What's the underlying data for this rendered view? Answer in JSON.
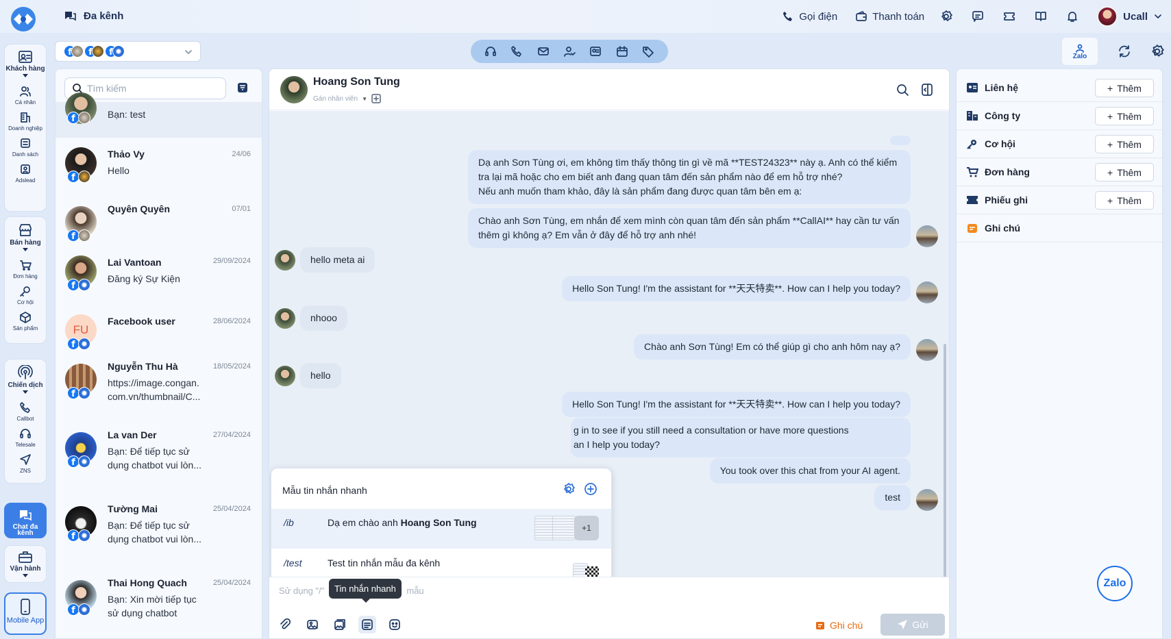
{
  "topbar": {
    "brand": "Đa kênh",
    "call": "Gọi điện",
    "payment": "Thanh toán",
    "user": "Ucall"
  },
  "rail": {
    "customers": "Khách hàng",
    "personal": "Cá nhân",
    "business": "Doanh nghiệp",
    "list": "Danh sách",
    "adslead": "Adslead",
    "sales": "Bán hàng",
    "orders": "Đơn hàng",
    "opportunity": "Cơ hội",
    "products": "Sản phẩm",
    "campaign": "Chiến dịch",
    "callbot": "Callbot",
    "telesale": "Telesale",
    "zns": "ZNS",
    "chat": "Chat đa kênh",
    "operations": "Vận hành",
    "mobile": "Mobile App"
  },
  "right_toolbar": {
    "zalo_tab": "Zalo"
  },
  "search": {
    "placeholder": "Tìm kiếm"
  },
  "conversations": [
    {
      "name": "",
      "date": "",
      "preview": "Bạn: test"
    },
    {
      "name": "Thảo Vy",
      "date": "24/06",
      "preview": "Hello"
    },
    {
      "name": "Quyên Quyên",
      "date": "07/01",
      "preview": ""
    },
    {
      "name": "Lai Vantoan",
      "date": "29/09/2024",
      "preview": "Đăng ký Sự Kiện"
    },
    {
      "name": "Facebook user",
      "date": "28/06/2024",
      "preview": "",
      "initials": "FU"
    },
    {
      "name": "Nguyễn Thu Hà",
      "date": "18/05/2024",
      "preview": "https://image.congan.com.vn/thumbnail/C..."
    },
    {
      "name": "La van Der",
      "date": "27/04/2024",
      "preview": "Bạn: Để tiếp tục sử dụng chatbot vui lòn..."
    },
    {
      "name": "Tường Mai",
      "date": "25/04/2024",
      "preview": "Bạn: Để tiếp tục sử dụng chatbot vui lòn..."
    },
    {
      "name": "Thai Hong Quach",
      "date": "25/04/2024",
      "preview": "Bạn: Xin mời tiếp tục sử dụng chatbot"
    }
  ],
  "chat": {
    "contact_name": "Hoang Son Tung",
    "assign": "Gán nhân viên",
    "messages": {
      "m1": "Dạ anh Sơn Tùng ơi, em không tìm thấy thông tin gì về mã **TEST24323** này ạ. Anh có thể kiểm tra lại mã hoặc cho em biết anh đang quan tâm đến sản phẩm nào để em hỗ trợ nhé?",
      "m1b": "Nếu anh muốn tham khảo, đây là sản phẩm đang được quan tâm bên em ạ:",
      "m2": "Chào anh Sơn Tùng, em nhắn để xem mình còn quan tâm đến sản phẩm **CallAI** hay cần tư vấn thêm gì không ạ? Em vẫn ở đây để hỗ trợ anh nhé!",
      "m3": "hello meta ai",
      "m4": "Hello Son Tung! I'm the assistant for **天天特卖**. How can I help you today?",
      "m5": "nhooo",
      "m6": "Chào anh Sơn Tùng! Em có thể giúp gì cho anh hôm nay ạ?",
      "m7": "hello",
      "m8": "Hello Son Tung! I'm the assistant for **天天特卖**. How can I help you today?",
      "m9a": "g in to see if you still need a consultation or have more questions",
      "m9b": "an I help you today?",
      "m10": "You took over this chat from your AI agent.",
      "m11": "test"
    },
    "input_placeholder": "Sử dụng \"/\"",
    "input_placeholder_tail": "mẫu",
    "tooltip": "Tin nhắn nhanh",
    "note": "Ghi chú",
    "send": "Gửi"
  },
  "quick_templates": {
    "title": "Mẫu tin nhắn nhanh",
    "items": [
      {
        "code": "/ib",
        "text_prefix": "Dạ em chào anh ",
        "text_bold": "Hoang Son Tung",
        "more": "+1"
      },
      {
        "code": "/test",
        "text_prefix": "Test tin nhắn mẫu đa kênh",
        "text_bold": ""
      }
    ]
  },
  "info_panel": {
    "contact": "Liên hệ",
    "company": "Công ty",
    "opportunity": "Cơ hội",
    "order": "Đơn hàng",
    "ticket": "Phiếu ghi",
    "note": "Ghi chú",
    "add": "Thêm"
  },
  "zalo_fab": "Zalo",
  "colors": {
    "accent": "#3b7fe6",
    "note": "#e76b12",
    "toolbar": "#a9c9ef"
  }
}
